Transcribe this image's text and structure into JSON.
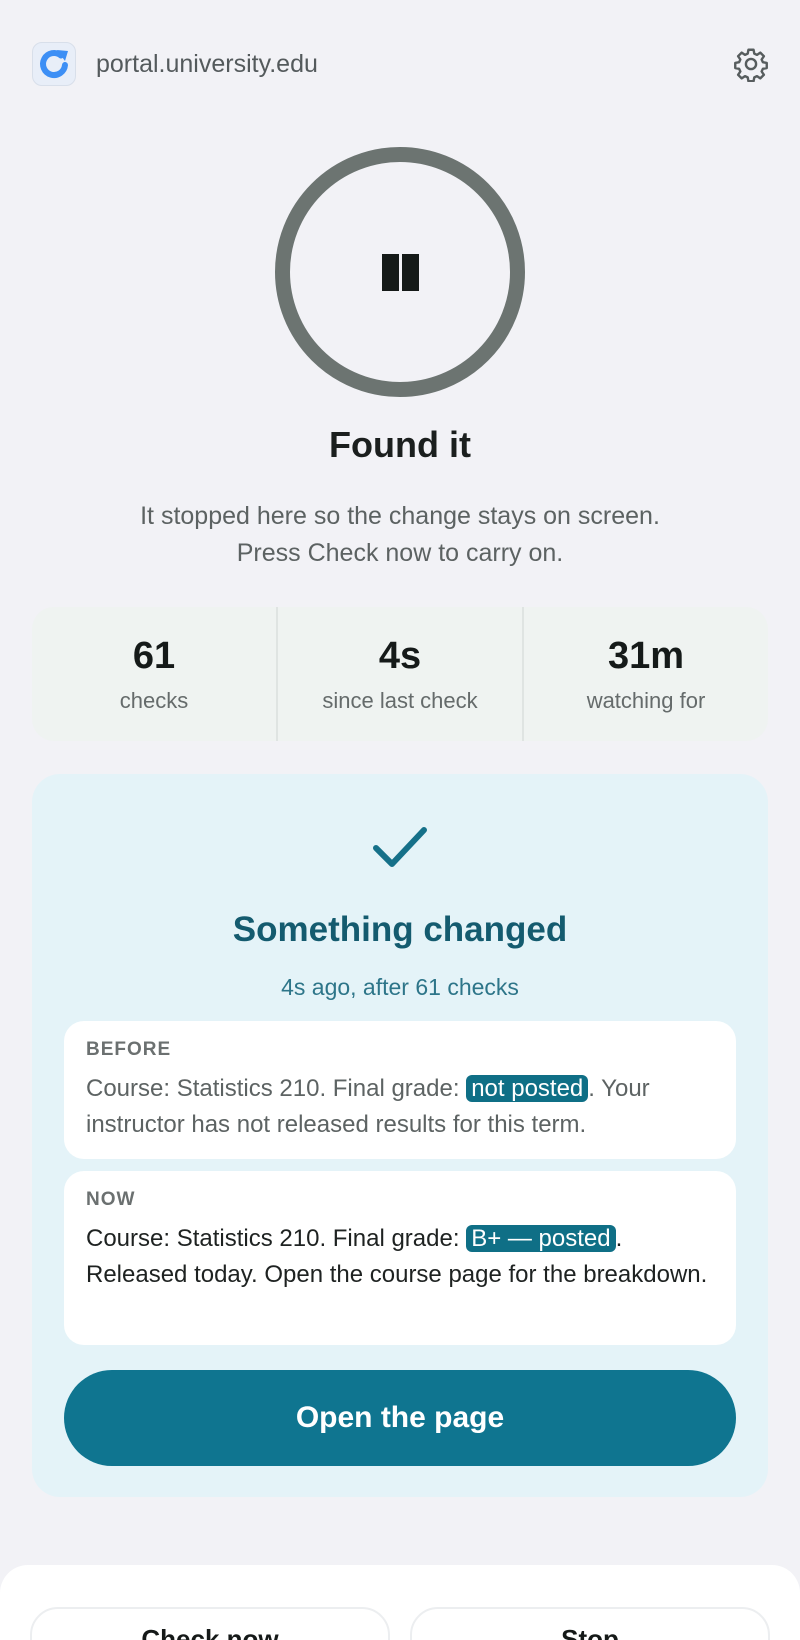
{
  "header": {
    "site": "portal.university.edu",
    "site_icon": "refresh-icon",
    "settings_icon": "gear-icon"
  },
  "status": {
    "icon": "pause-icon",
    "title": "Found it",
    "message": "It stopped here so the change stays on screen. Press Check now to carry on."
  },
  "stats": [
    {
      "value": "61",
      "label": "checks"
    },
    {
      "value": "4s",
      "label": "since last check"
    },
    {
      "value": "31m",
      "label": "watching for"
    }
  ],
  "change": {
    "icon": "checkmark-icon",
    "title": "Something changed",
    "subtitle": "4s ago, after 61 checks",
    "before": {
      "label": "BEFORE",
      "prefix": "Course: Statistics 210. Final grade: ",
      "highlight": "not posted",
      "suffix": ". Your instructor has not released results for this term."
    },
    "now": {
      "label": "NOW",
      "prefix": "Course: Statistics 210. Final grade: ",
      "highlight": "B+ — posted",
      "suffix": ". Released today. Open the course page for the breakdown."
    },
    "open_button": "Open the page"
  },
  "actions": {
    "check_now": "Check now",
    "stop": "Stop"
  },
  "colors": {
    "accent": "#0f7590",
    "highlight": "#0f6f86",
    "card_bg": "#e4f3f8",
    "ring": "#6c7471"
  }
}
